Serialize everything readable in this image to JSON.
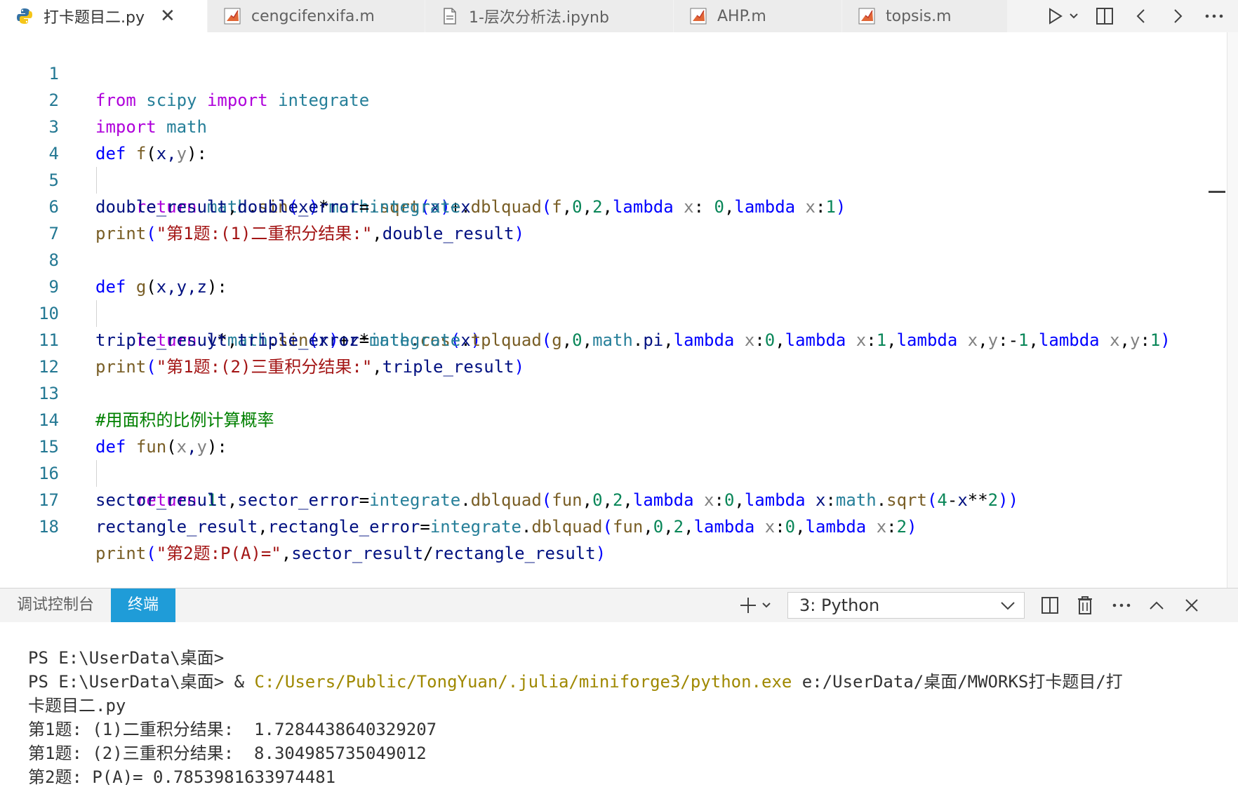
{
  "tabs": [
    {
      "label": "打卡题目二.py",
      "icon": "python-icon",
      "active": true
    },
    {
      "label": "cengcifenxifa.m",
      "icon": "matlab-icon",
      "active": false
    },
    {
      "label": "1-层次分析法.ipynb",
      "icon": "notebook-file-icon",
      "active": false
    },
    {
      "label": "AHP.m",
      "icon": "matlab-icon",
      "active": false
    },
    {
      "label": "topsis.m",
      "icon": "matlab-icon",
      "active": false
    }
  ],
  "editor": {
    "line_numbers": [
      "1",
      "2",
      "3",
      "4",
      "5",
      "6",
      "7",
      "8",
      "9",
      "10",
      "11",
      "12",
      "13",
      "14",
      "15",
      "16",
      "17",
      "18"
    ],
    "lines": [
      "from scipy import integrate",
      "import math",
      "def f(x,y):",
      "    return math.sin(x)*math.sqrt(x)+x",
      "double_result,double_error=integrate.dblquad(f,0,2,lambda x: 0,lambda x:1)",
      "print(\"第1题: (1)二重积分结果: \",double_result)",
      "",
      "def g(x,y,z):",
      "    return y*math.sin(x)+z*math.cos(x)",
      "triple_result,triple_error=integrate.tplquad(g,0,math.pi,lambda x:0,lambda x:1,lambda x,y:-1,lambda x,y:1)",
      "print(\"第1题: (2)三重积分结果: \",triple_result)",
      "",
      "#用面积的比例计算概率",
      "def fun(x,y):",
      "    return 1",
      "sector_result,sector_error=integrate.dblquad(fun,0,2,lambda x:0,lambda x:math.sqrt(4-x**2))",
      "rectangle_result,rectangle_error=integrate.dblquad(fun,0,2,lambda x:0,lambda x:2)",
      "print(\"第2题: P(A)=\",sector_result/rectangle_result)"
    ]
  },
  "panel": {
    "tab_debug": "调试控制台",
    "tab_terminal": "终端",
    "terminal_select": "3: Python",
    "terminal_lines": [
      {
        "prompt": "PS E:\\UserData\\桌面> ",
        "cmd": "",
        "path": "",
        "rest": ""
      },
      {
        "prompt": "PS E:\\UserData\\桌面> ",
        "cmd": "& ",
        "path": "C:/Users/Public/TongYuan/.julia/miniforge3/python.exe",
        "rest": " e:/UserData/桌面/MWORKS打卡题目/打"
      },
      {
        "prompt": "",
        "cmd": "",
        "path": "",
        "rest": "卡题目二.py"
      },
      {
        "prompt": "",
        "cmd": "",
        "path": "",
        "rest": "第1题: (1)二重积分结果:  1.7284438640329207"
      },
      {
        "prompt": "",
        "cmd": "",
        "path": "",
        "rest": "第1题: (2)三重积分结果:  8.304985735049012"
      },
      {
        "prompt": "",
        "cmd": "",
        "path": "",
        "rest": "第2题: P(A)= 0.7853981633974481"
      }
    ]
  },
  "colors": {
    "accent": "#1f9cd8",
    "line_number": "#237893",
    "keyword": "#0000ff",
    "control": "#af00db",
    "string": "#a31515",
    "comment": "#008000"
  }
}
